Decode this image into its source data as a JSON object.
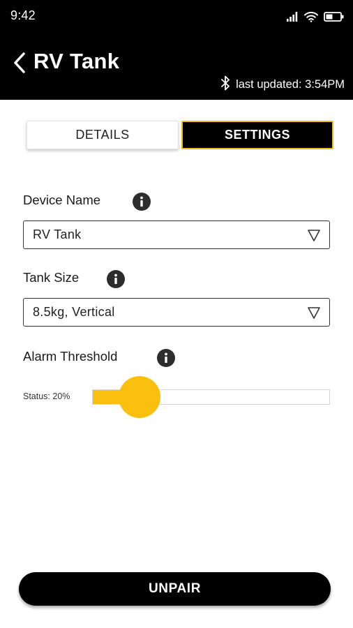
{
  "status_bar": {
    "time": "9:42",
    "icons": [
      "cellular-signal-icon",
      "wifi-icon",
      "battery-icon"
    ]
  },
  "header": {
    "title": "RV Tank",
    "back_icon": "chevron-left-icon",
    "bluetooth_icon": "bluetooth-icon",
    "last_updated": "last updated: 3:54PM"
  },
  "tabs": [
    {
      "label": "DETAILS",
      "active": false
    },
    {
      "label": "SETTINGS",
      "active": true
    }
  ],
  "fields": {
    "device_name": {
      "label": "Device Name",
      "value": "RV Tank"
    },
    "tank_size": {
      "label": "Tank Size",
      "value": "8.5kg, Vertical"
    },
    "alarm_threshold": {
      "label": "Alarm Threshold",
      "status_text": "Status: 20%",
      "value_percent": 20
    }
  },
  "actions": {
    "unpair_label": "UNPAIR"
  },
  "colors": {
    "header_bg": "#000000",
    "accent": "#fbbf0f",
    "tab_border": "#f0ba1f",
    "button_bg": "#000000"
  }
}
